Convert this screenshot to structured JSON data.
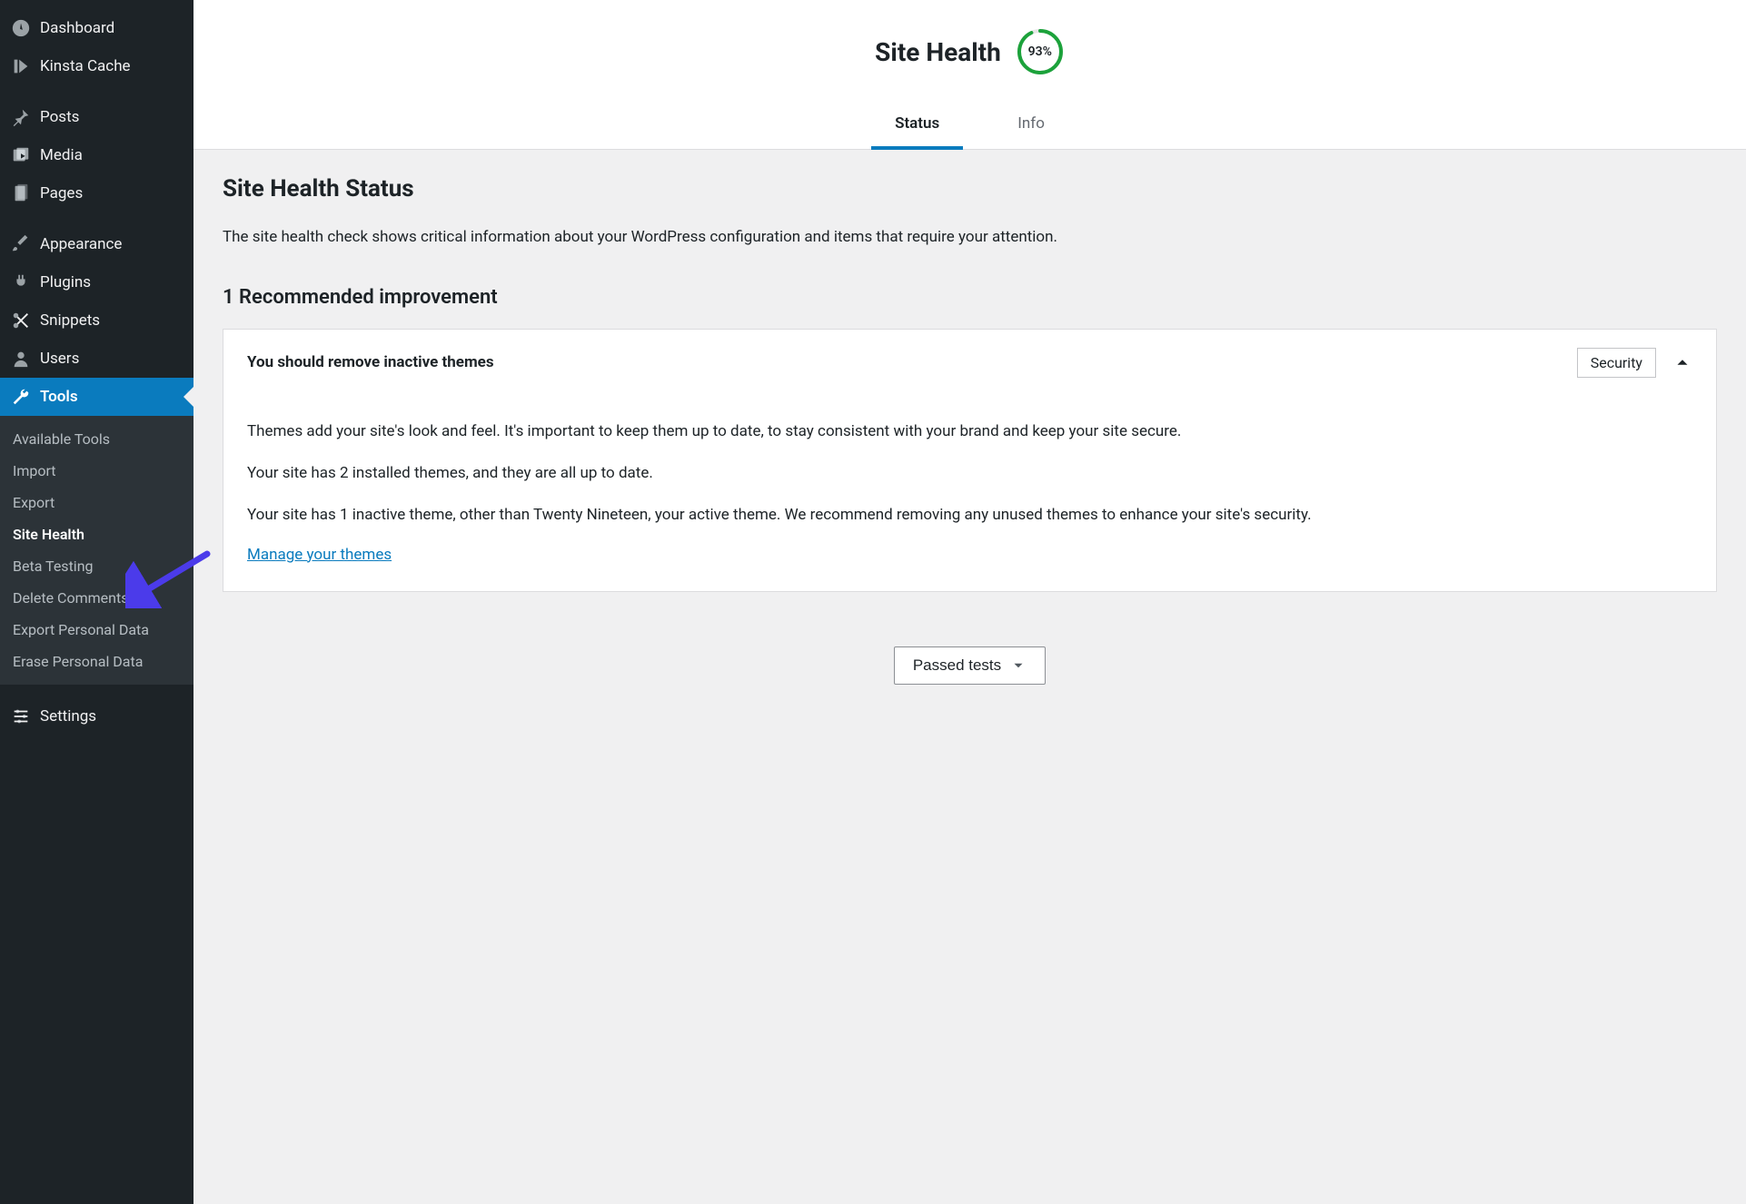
{
  "sidebar": {
    "items": [
      {
        "label": "Dashboard",
        "icon": "dashboard-icon"
      },
      {
        "label": "Kinsta Cache",
        "icon": "kinsta-icon"
      },
      {
        "gap": true
      },
      {
        "label": "Posts",
        "icon": "pin-icon"
      },
      {
        "label": "Media",
        "icon": "media-icon"
      },
      {
        "label": "Pages",
        "icon": "pages-icon"
      },
      {
        "gap": true
      },
      {
        "label": "Appearance",
        "icon": "brush-icon"
      },
      {
        "label": "Plugins",
        "icon": "plug-icon"
      },
      {
        "label": "Snippets",
        "icon": "scissors-icon"
      },
      {
        "label": "Users",
        "icon": "user-icon"
      },
      {
        "label": "Tools",
        "icon": "wrench-icon",
        "current": true
      },
      {
        "label": "Settings",
        "icon": "sliders-icon",
        "afterTools": true
      }
    ],
    "tools_sub": [
      {
        "label": "Available Tools"
      },
      {
        "label": "Import"
      },
      {
        "label": "Export"
      },
      {
        "label": "Site Health",
        "current": true
      },
      {
        "label": "Beta Testing"
      },
      {
        "label": "Delete Comments"
      },
      {
        "label": "Export Personal Data"
      },
      {
        "label": "Erase Personal Data"
      }
    ]
  },
  "header": {
    "title": "Site Health",
    "progress_pct": "93%",
    "progress_value": 93,
    "tabs": [
      {
        "label": "Status",
        "active": true
      },
      {
        "label": "Info"
      }
    ]
  },
  "status": {
    "title": "Site Health Status",
    "description": "The site health check shows critical information about your WordPress configuration and items that require your attention.",
    "rec_heading": "1 Recommended improvement",
    "issue": {
      "title": "You should remove inactive themes",
      "badge": "Security",
      "p1": "Themes add your site's look and feel. It's important to keep them up to date, to stay consistent with your brand and keep your site secure.",
      "p2": "Your site has 2 installed themes, and they are all up to date.",
      "p3": "Your site has 1 inactive theme, other than Twenty Nineteen, your active theme. We recommend removing any unused themes to enhance your site's security.",
      "link": "Manage your themes"
    },
    "passed_btn": "Passed tests"
  }
}
